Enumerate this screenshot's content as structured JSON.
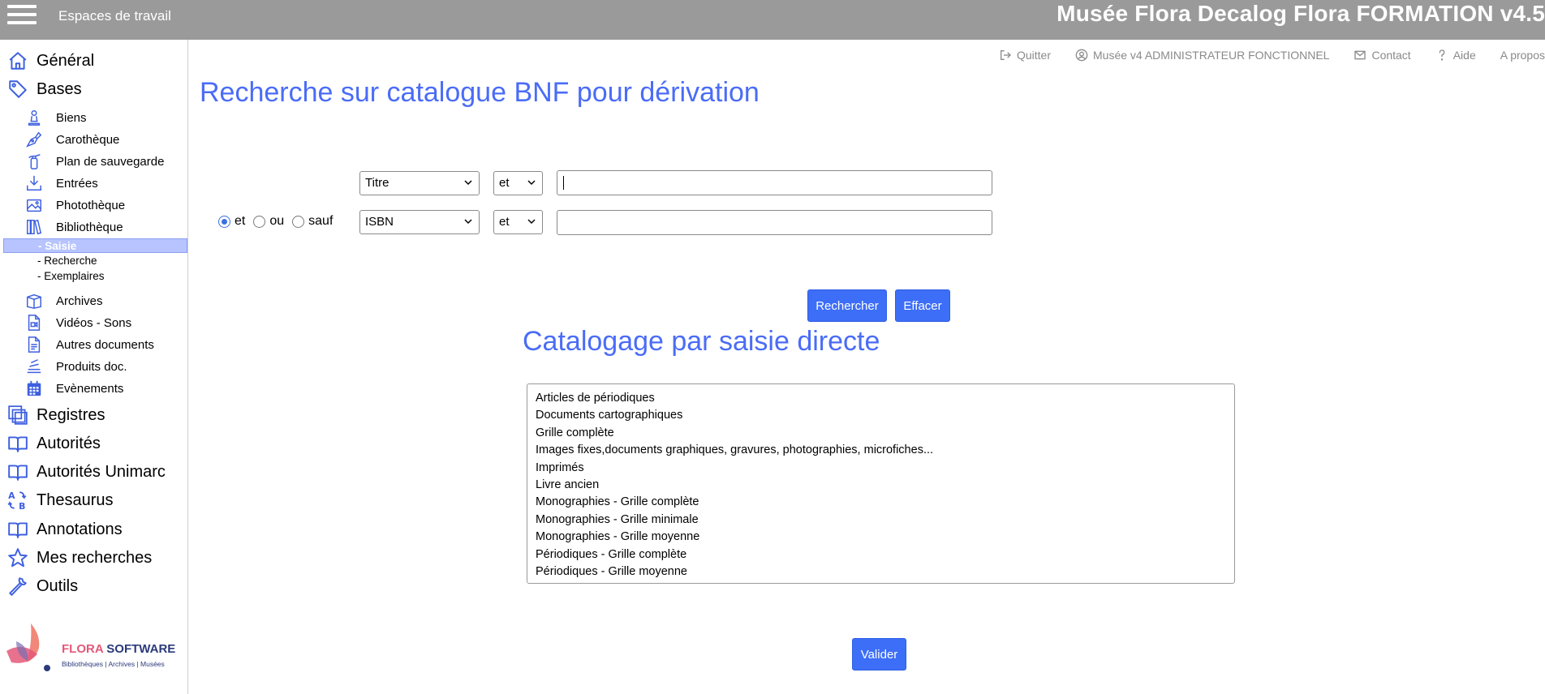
{
  "topbar": {
    "workspaces_label": "Espaces de travail",
    "app_title": "Musée Flora Decalog Flora FORMATION v4.5"
  },
  "sidebar": {
    "top_items": [
      {
        "label": "Général",
        "icon": "home-icon"
      },
      {
        "label": "Bases",
        "icon": "tag-icon"
      }
    ],
    "bases_items": [
      {
        "label": "Biens",
        "icon": "statue-icon"
      },
      {
        "label": "Carothèque",
        "icon": "pen-nib-icon"
      },
      {
        "label": "Plan de sauvegarde",
        "icon": "fire-extinguisher-icon"
      },
      {
        "label": "Entrées",
        "icon": "download-tray-icon"
      },
      {
        "label": "Photothèque",
        "icon": "image-icon"
      },
      {
        "label": "Bibliothèque",
        "icon": "books-icon"
      }
    ],
    "bibliotheque_leaves": [
      {
        "label": "- Saisie",
        "active": true
      },
      {
        "label": "- Recherche",
        "active": false
      },
      {
        "label": "- Exemplaires",
        "active": false
      }
    ],
    "bases_items_2": [
      {
        "label": "Archives",
        "icon": "archive-box-icon"
      },
      {
        "label": "Vidéos - Sons",
        "icon": "video-file-icon"
      },
      {
        "label": "Autres documents",
        "icon": "document-icon"
      },
      {
        "label": "Produits doc.",
        "icon": "stack-icon"
      },
      {
        "label": "Evènements",
        "icon": "calendar-icon"
      }
    ],
    "bottom_items": [
      {
        "label": "Registres",
        "icon": "copy-icon"
      },
      {
        "label": "Autorités",
        "icon": "book-open-icon"
      },
      {
        "label": "Autorités Unimarc",
        "icon": "book-open-icon"
      },
      {
        "label": "Thesaurus",
        "icon": "sort-alpha-icon"
      },
      {
        "label": "Annotations",
        "icon": "book-open-icon"
      },
      {
        "label": "Mes recherches",
        "icon": "star-icon"
      },
      {
        "label": "Outils",
        "icon": "wrench-icon"
      }
    ],
    "logo": {
      "name_part1": "FLORA",
      "name_part2": "SOFTWARE",
      "tagline": "Bibliothèques | Archives | Musées"
    }
  },
  "header_links": [
    {
      "label": "Quitter",
      "icon": "logout-icon"
    },
    {
      "label": "Musée v4 ADMINISTRATEUR FONCTIONNEL",
      "icon": "user-circle-icon"
    },
    {
      "label": "Contact",
      "icon": "envelope-icon"
    },
    {
      "label": "Aide",
      "icon": "question-icon"
    },
    {
      "label": "A propos",
      "icon": ""
    }
  ],
  "main": {
    "page_title": "Recherche sur catalogue BNF pour dérivation",
    "search_rows": [
      {
        "field": "Titre",
        "operator": "et",
        "value": ""
      },
      {
        "field": "ISBN",
        "operator": "et",
        "value": ""
      }
    ],
    "combinators": [
      {
        "label": "et",
        "checked": true
      },
      {
        "label": "ou",
        "checked": false
      },
      {
        "label": "sauf",
        "checked": false
      }
    ],
    "search_button": "Rechercher",
    "clear_button": "Effacer",
    "section_title": "Catalogage par saisie directe",
    "catalog_options": [
      "Articles de périodiques",
      "Documents cartographiques",
      "Grille complète",
      "Images fixes,documents graphiques, gravures, photographies, microfiches...",
      "Imprimés",
      "Livre ancien",
      "Monographies - Grille complète",
      "Monographies - Grille minimale",
      "Monographies - Grille moyenne",
      "Périodiques - Grille complète",
      "Périodiques - Grille moyenne"
    ],
    "validate_button": "Valider"
  },
  "colors": {
    "topbar_bg": "#9a9a9a",
    "accent": "#4a6cf7",
    "button": "#3d6ef7",
    "active_item": "#b7c4ff"
  }
}
